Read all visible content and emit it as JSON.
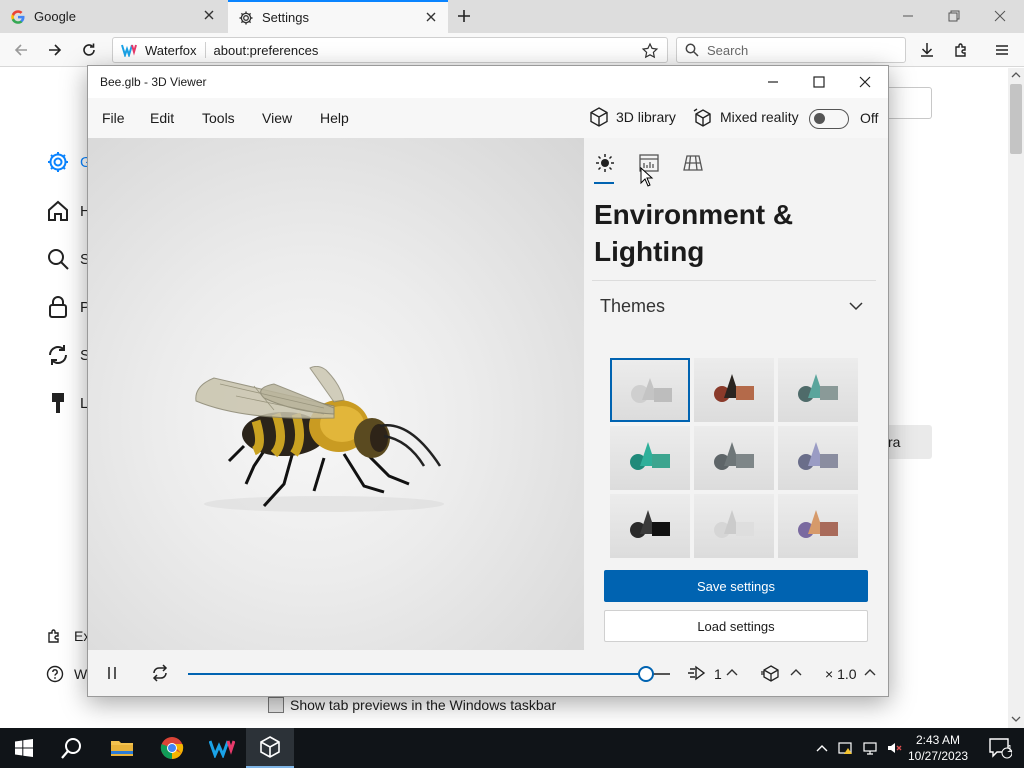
{
  "browser": {
    "tabs": [
      {
        "label": "Google",
        "icon": "google-g-icon",
        "active": false
      },
      {
        "label": "Settings",
        "icon": "gear-icon",
        "active": true
      }
    ],
    "identity_label": "Waterfox",
    "url": "about:preferences",
    "search_placeholder": "Search"
  },
  "page": {
    "sidebar": [
      {
        "label": "G",
        "icon": "gear-icon"
      },
      {
        "label": "H",
        "icon": "home-icon"
      },
      {
        "label": "S",
        "icon": "search-icon"
      },
      {
        "label": "P",
        "icon": "lock-icon"
      },
      {
        "label": "S",
        "icon": "sync-icon"
      },
      {
        "label": "L",
        "icon": "brush-icon"
      }
    ],
    "bottom_links": [
      {
        "label": "Ex",
        "icon": "extensions-icon"
      },
      {
        "label": "W",
        "icon": "help-icon"
      }
    ],
    "partial_right_text": "ra",
    "tab_preview_checkbox": "Show tab previews in the Windows taskbar"
  },
  "viewer": {
    "title": "Bee.glb - 3D Viewer",
    "menu": [
      "File",
      "Edit",
      "Tools",
      "View",
      "Help"
    ],
    "library_label": "3D library",
    "mixed_reality_label": "Mixed reality",
    "mixed_reality_state": "Off",
    "panel": {
      "heading": "Environment & Lighting",
      "section_label": "Themes",
      "selected_theme": 0,
      "save_label": "Save settings",
      "load_label": "Load settings"
    },
    "controls": {
      "playback_progress": 0.95,
      "speed_label": "1",
      "scale_label": "× 1.0"
    }
  },
  "taskbar": {
    "time": "2:43 AM",
    "date": "10/27/2023",
    "notification_count": "1"
  },
  "colors": {
    "accent": "#0063b1",
    "firefox_blue": "#0a84ff",
    "taskbar": "#101418"
  }
}
